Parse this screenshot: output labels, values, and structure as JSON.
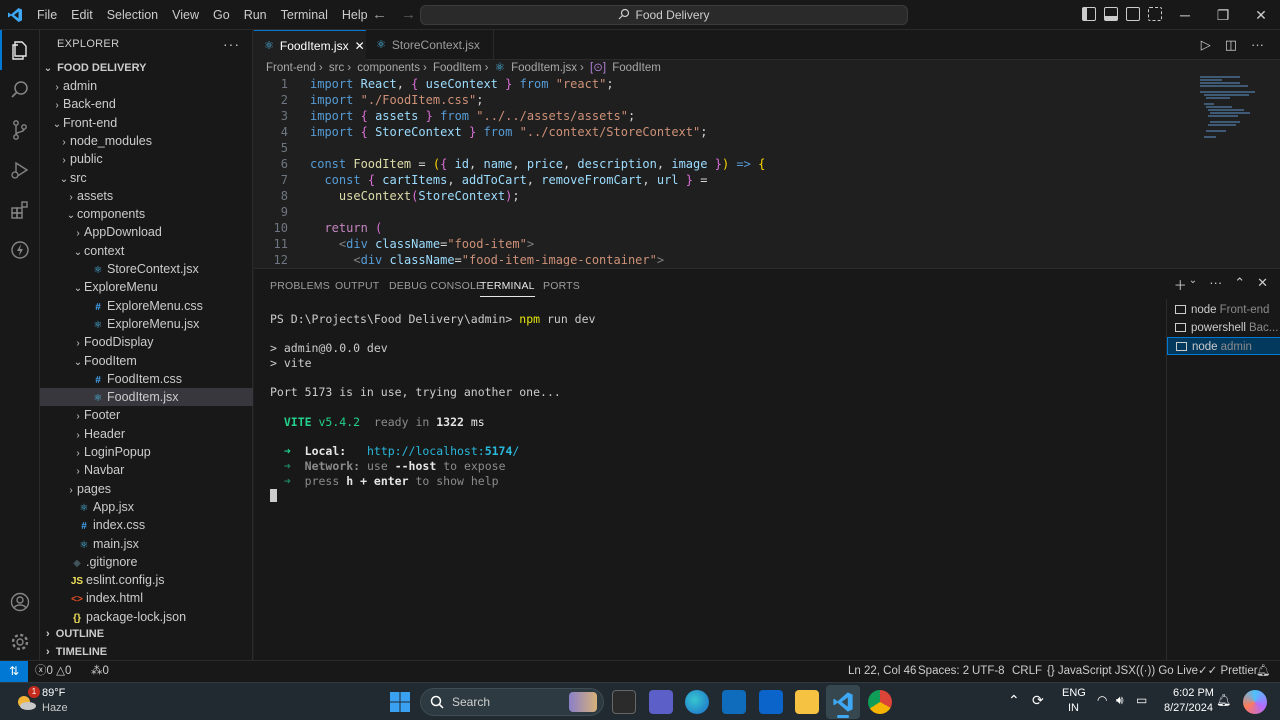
{
  "titlebar": {
    "menu": [
      "File",
      "Edit",
      "Selection",
      "View",
      "Go",
      "Run",
      "Terminal",
      "Help"
    ],
    "command_center": "Food Delivery"
  },
  "sidebar": {
    "title": "EXPLORER",
    "root": "FOOD DELIVERY",
    "tree": [
      {
        "label": "admin",
        "depth": 1,
        "kind": "folder",
        "open": false
      },
      {
        "label": "Back-end",
        "depth": 1,
        "kind": "folder",
        "open": false
      },
      {
        "label": "Front-end",
        "depth": 1,
        "kind": "folder",
        "open": true
      },
      {
        "label": "node_modules",
        "depth": 2,
        "kind": "folder",
        "open": false
      },
      {
        "label": "public",
        "depth": 2,
        "kind": "folder",
        "open": false
      },
      {
        "label": "src",
        "depth": 2,
        "kind": "folder",
        "open": true
      },
      {
        "label": "assets",
        "depth": 3,
        "kind": "folder",
        "open": false
      },
      {
        "label": "components",
        "depth": 3,
        "kind": "folder",
        "open": true
      },
      {
        "label": "AppDownload",
        "depth": 4,
        "kind": "folder",
        "open": false
      },
      {
        "label": "context",
        "depth": 4,
        "kind": "folder",
        "open": true
      },
      {
        "label": "StoreContext.jsx",
        "depth": 5,
        "kind": "react"
      },
      {
        "label": "ExploreMenu",
        "depth": 4,
        "kind": "folder",
        "open": true
      },
      {
        "label": "ExploreMenu.css",
        "depth": 5,
        "kind": "css"
      },
      {
        "label": "ExploreMenu.jsx",
        "depth": 5,
        "kind": "react"
      },
      {
        "label": "FoodDisplay",
        "depth": 4,
        "kind": "folder",
        "open": false
      },
      {
        "label": "FoodItem",
        "depth": 4,
        "kind": "folder",
        "open": true
      },
      {
        "label": "FoodItem.css",
        "depth": 5,
        "kind": "css"
      },
      {
        "label": "FoodItem.jsx",
        "depth": 5,
        "kind": "react",
        "selected": true
      },
      {
        "label": "Footer",
        "depth": 4,
        "kind": "folder",
        "open": false
      },
      {
        "label": "Header",
        "depth": 4,
        "kind": "folder",
        "open": false
      },
      {
        "label": "LoginPopup",
        "depth": 4,
        "kind": "folder",
        "open": false
      },
      {
        "label": "Navbar",
        "depth": 4,
        "kind": "folder",
        "open": false
      },
      {
        "label": "pages",
        "depth": 3,
        "kind": "folder",
        "open": false
      },
      {
        "label": "App.jsx",
        "depth": 3,
        "kind": "react"
      },
      {
        "label": "index.css",
        "depth": 3,
        "kind": "css"
      },
      {
        "label": "main.jsx",
        "depth": 3,
        "kind": "react"
      },
      {
        "label": ".gitignore",
        "depth": 2,
        "kind": "git"
      },
      {
        "label": "eslint.config.js",
        "depth": 2,
        "kind": "js"
      },
      {
        "label": "index.html",
        "depth": 2,
        "kind": "html"
      },
      {
        "label": "package-lock.json",
        "depth": 2,
        "kind": "json"
      }
    ],
    "outline": "OUTLINE",
    "timeline": "TIMELINE"
  },
  "tabs": [
    {
      "label": "FoodItem.jsx",
      "active": true
    },
    {
      "label": "StoreContext.jsx",
      "active": false
    }
  ],
  "breadcrumb": [
    "Front-end",
    "src",
    "components",
    "FoodItem",
    "FoodItem.jsx",
    "FoodItem"
  ],
  "editor": {
    "lines": [
      "import React, { useContext } from \"react\";",
      "import \"./FoodItem.css\";",
      "import { assets } from \"../../assets/assets\";",
      "import { StoreContext } from \"../context/StoreContext\";",
      "",
      "const FoodItem = ({ id, name, price, description, image }) => {",
      "  const { cartItems, addToCart, removeFromCart, url } =",
      "    useContext(StoreContext);",
      "",
      "  return (",
      "    <div className=\"food-item\">",
      "      <div className=\"food-item-image-container\">"
    ]
  },
  "panel": {
    "tabs": [
      "PROBLEMS",
      "OUTPUT",
      "DEBUG CONSOLE",
      "TERMINAL",
      "PORTS"
    ],
    "active_tab": "TERMINAL",
    "terminal": {
      "prompt": "PS D:\\Projects\\Food Delivery\\admin>",
      "command": "npm",
      "command_args": " run dev",
      "script_line": "> admin@0.0.0 dev",
      "vite_line": "> vite",
      "port_msg": "Port 5173 is in use, trying another one...",
      "vite_label": "VITE",
      "vite_version": "v5.4.2",
      "ready_text": "ready in",
      "ready_ms": "1322",
      "ms": "ms",
      "local_label": "Local:",
      "local_url_prefix": "http://localhost:",
      "local_port": "5174",
      "local_url_suffix": "/",
      "network_label": "Network:",
      "network_use": "use",
      "network_flag": "--host",
      "network_rest": "to expose",
      "help_press": "press",
      "help_keys": "h + enter",
      "help_rest": "to show help"
    },
    "terminal_list": [
      {
        "name": "node",
        "sub": "Front-end",
        "active": false
      },
      {
        "name": "powershell",
        "sub": "Bac...",
        "active": false
      },
      {
        "name": "node",
        "sub": "admin",
        "active": true
      }
    ]
  },
  "statusbar": {
    "errors": "0",
    "warnings": "0",
    "ports": "0",
    "position": "Ln 22, Col 46",
    "spaces": "Spaces: 2",
    "encoding": "UTF-8",
    "eol": "CRLF",
    "language": "JavaScript JSX",
    "golive": "Go Live",
    "prettier": "Prettier"
  },
  "taskbar": {
    "weather_temp": "89°F",
    "weather_desc": "Haze",
    "weather_badge": "1",
    "search_placeholder": "Search",
    "lang": "ENG",
    "region": "IN",
    "time": "6:02 PM",
    "date": "8/27/2024"
  },
  "colors": {
    "accent": "#0078d4",
    "bg": "#1f1f1f",
    "sidebar": "#181818"
  }
}
